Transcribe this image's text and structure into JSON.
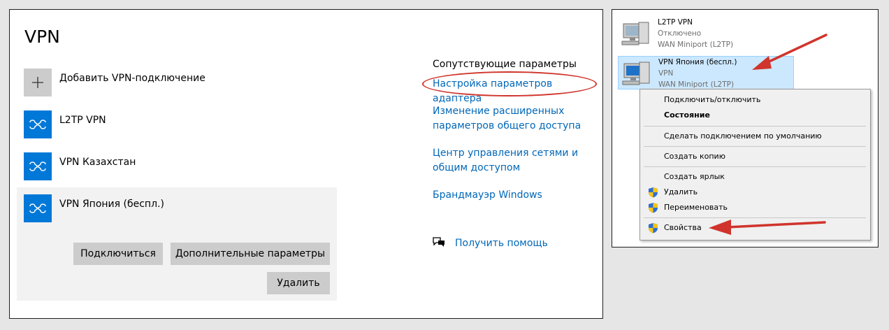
{
  "vpn_settings": {
    "title": "VPN",
    "add_label": "Добавить VPN-подключение",
    "connections": [
      {
        "name": "L2TP VPN"
      },
      {
        "name": "VPN Казахстан"
      },
      {
        "name": "VPN Япония (беспл.)"
      }
    ],
    "buttons": {
      "connect": "Подключиться",
      "advanced": "Дополнительные параметры",
      "delete": "Удалить"
    },
    "related": {
      "title": "Сопутствующие параметры",
      "links": [
        "Настройка параметров адаптера",
        "Изменение расширенных параметров общего доступа",
        "Центр управления сетями и общим доступом",
        "Брандмауэр Windows"
      ]
    },
    "help_label": "Получить помощь"
  },
  "network_connections": {
    "items": [
      {
        "name": "L2TP VPN",
        "status": "Отключено",
        "device": "WAN Miniport (L2TP)"
      },
      {
        "name": "VPN Япония (беспл.)",
        "status": "VPN",
        "device": "WAN Miniport (L2TP)"
      }
    ]
  },
  "context_menu": {
    "items": [
      "Подключить/отключить",
      "Состояние",
      "Сделать подключением по умолчанию",
      "Создать копию",
      "Создать ярлык",
      "Удалить",
      "Переименовать",
      "Свойства"
    ]
  },
  "colors": {
    "accent_blue": "#0078d7",
    "link_blue": "#0067b8",
    "annotation_red": "#d0342c",
    "selection_blue": "#cce8ff"
  }
}
